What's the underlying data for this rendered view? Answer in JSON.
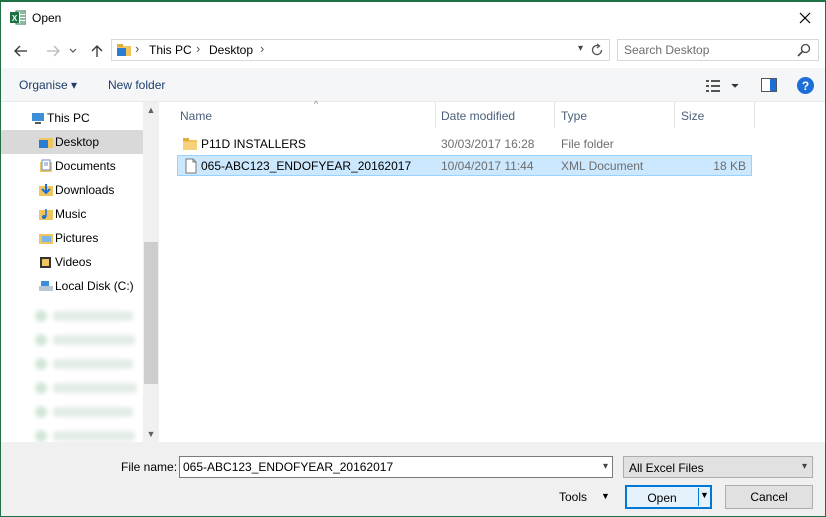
{
  "window": {
    "title": "Open",
    "app_icon_letter": "X"
  },
  "navbar": {
    "breadcrumbs": [
      "This PC",
      "Desktop"
    ],
    "search_placeholder": "Search Desktop"
  },
  "toolbar": {
    "organise_label": "Organise ▾",
    "new_folder_label": "New folder",
    "help_label": "?"
  },
  "navpane": {
    "items": [
      {
        "label": "This PC",
        "icon": "computer-icon"
      },
      {
        "label": "Desktop",
        "icon": "desktop-folder-icon",
        "selected": true
      },
      {
        "label": "Documents",
        "icon": "documents-icon"
      },
      {
        "label": "Downloads",
        "icon": "downloads-icon"
      },
      {
        "label": "Music",
        "icon": "music-icon"
      },
      {
        "label": "Pictures",
        "icon": "pictures-icon"
      },
      {
        "label": "Videos",
        "icon": "videos-icon"
      },
      {
        "label": "Local Disk (C:)",
        "icon": "drive-icon"
      }
    ]
  },
  "columns": {
    "name": "Name",
    "date": "Date modified",
    "type": "Type",
    "size": "Size"
  },
  "files": [
    {
      "name": "P11D INSTALLERS",
      "date": "30/03/2017 16:28",
      "type": "File folder",
      "size": "",
      "icon": "folder-icon"
    },
    {
      "name": "065-ABC123_ENDOFYEAR_20162017",
      "date": "10/04/2017 11:44",
      "type": "XML Document",
      "size": "18 KB",
      "icon": "document-icon",
      "selected": true
    }
  ],
  "bottom": {
    "file_name_label": "File name:",
    "file_name_value": "065-ABC123_ENDOFYEAR_20162017",
    "file_type_value": "All Excel Files",
    "tools_label": "Tools",
    "open_label": "Open",
    "cancel_label": "Cancel"
  },
  "colors": {
    "excel_green": "#1e7145",
    "selection": "#cce8ff",
    "accent_blue": "#0078d7"
  }
}
